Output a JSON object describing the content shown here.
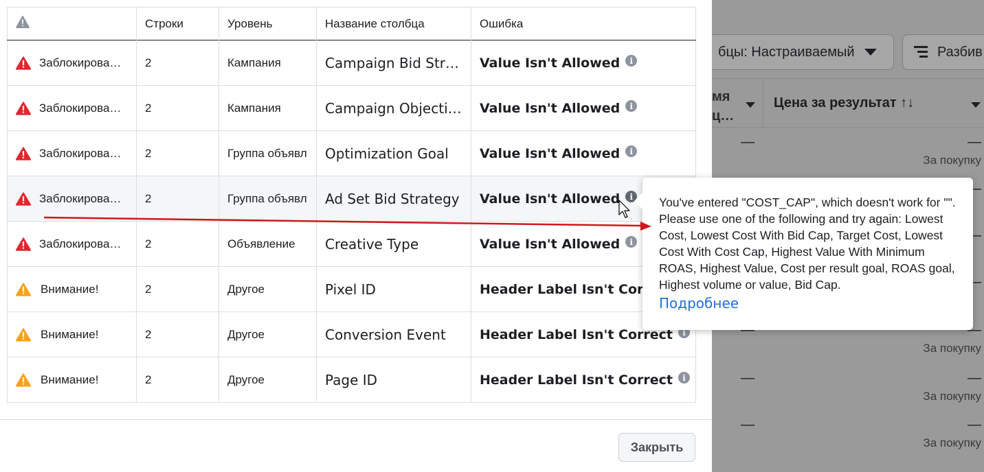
{
  "background": {
    "columns_button_label": "бцы: Настраиваемый",
    "breakdown_button_label": "Разбив",
    "header_left_line1": "мя",
    "header_left_line2": "ц…",
    "header_price": "Цена за результат ↑↓",
    "rows": [
      {
        "dash_left": "—",
        "dash_right": "—",
        "per": "За покупку"
      },
      {
        "dash_left": "",
        "dash_right": "—",
        "per": ""
      },
      {
        "dash_left": "",
        "dash_right": "—",
        "per": ""
      },
      {
        "dash_left": "",
        "dash_right": "—",
        "per": ""
      },
      {
        "dash_left": "—",
        "dash_right": "—",
        "per": "За покупку"
      },
      {
        "dash_left": "—",
        "dash_right": "—",
        "per": "За покупку"
      },
      {
        "dash_left": "—",
        "dash_right": "—",
        "per": "За покупку"
      }
    ]
  },
  "table": {
    "headers": [
      "",
      "Строки",
      "Уровень",
      "Название столбца",
      "Ошибка"
    ],
    "rows": [
      {
        "type": "error",
        "status": "Заблокирова…",
        "rows": "2",
        "level": "Кампания",
        "column": "Campaign Bid Strat…",
        "error": "Value Isn't Allowed"
      },
      {
        "type": "error",
        "status": "Заблокирова…",
        "rows": "2",
        "level": "Кампания",
        "column": "Campaign Objective",
        "error": "Value Isn't Allowed"
      },
      {
        "type": "error",
        "status": "Заблокирова…",
        "rows": "2",
        "level": "Группа объявл",
        "column": "Optimization Goal",
        "error": "Value Isn't Allowed"
      },
      {
        "type": "error",
        "status": "Заблокирова…",
        "rows": "2",
        "level": "Группа объявл",
        "column": "Ad Set Bid Strategy",
        "error": "Value Isn't Allowed"
      },
      {
        "type": "error",
        "status": "Заблокирова…",
        "rows": "2",
        "level": "Объявление",
        "column": "Creative Type",
        "error": "Value Isn't Allowed"
      },
      {
        "type": "warning",
        "status": "Внимание!",
        "rows": "2",
        "level": "Другое",
        "column": "Pixel ID",
        "error": "Header Label Isn't Correct"
      },
      {
        "type": "warning",
        "status": "Внимание!",
        "rows": "2",
        "level": "Другое",
        "column": "Conversion Event",
        "error": "Header Label Isn't Correct"
      },
      {
        "type": "warning",
        "status": "Внимание!",
        "rows": "2",
        "level": "Другое",
        "column": "Page ID",
        "error": "Header Label Isn't Correct"
      }
    ]
  },
  "tooltip": {
    "text": "You've entered \"COST_CAP\", which doesn't work for \"\". Please use one of the following and try again: Lowest Cost, Lowest Cost With Bid Cap, Target Cost, Lowest Cost With Cost Cap, Highest Value With Minimum ROAS, Highest Value, Cost per result goal, ROAS goal, Highest volume or value, Bid Cap.",
    "link": "Подробнее"
  },
  "footer": {
    "close_label": "Закрыть"
  },
  "colors": {
    "error_red": "#e0262f",
    "warning_orange": "#f7a21b",
    "link_blue": "#216fdb",
    "arrow_red": "#d0161c"
  }
}
